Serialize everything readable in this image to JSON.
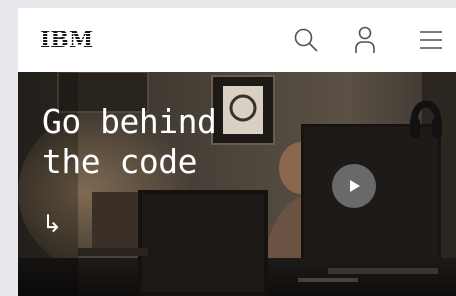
{
  "header": {
    "logo_text": "IBM",
    "icons": {
      "search": "search-icon",
      "user": "user-icon",
      "menu": "hamburger-menu-icon"
    }
  },
  "hero": {
    "title_line1": "Go behind",
    "title_line2": "the code",
    "arrow_glyph": "↳",
    "video_icon": "play-icon"
  },
  "colors": {
    "text_dark": "#161616",
    "hero_text": "#ffffff",
    "background": "#e6e8ec"
  }
}
